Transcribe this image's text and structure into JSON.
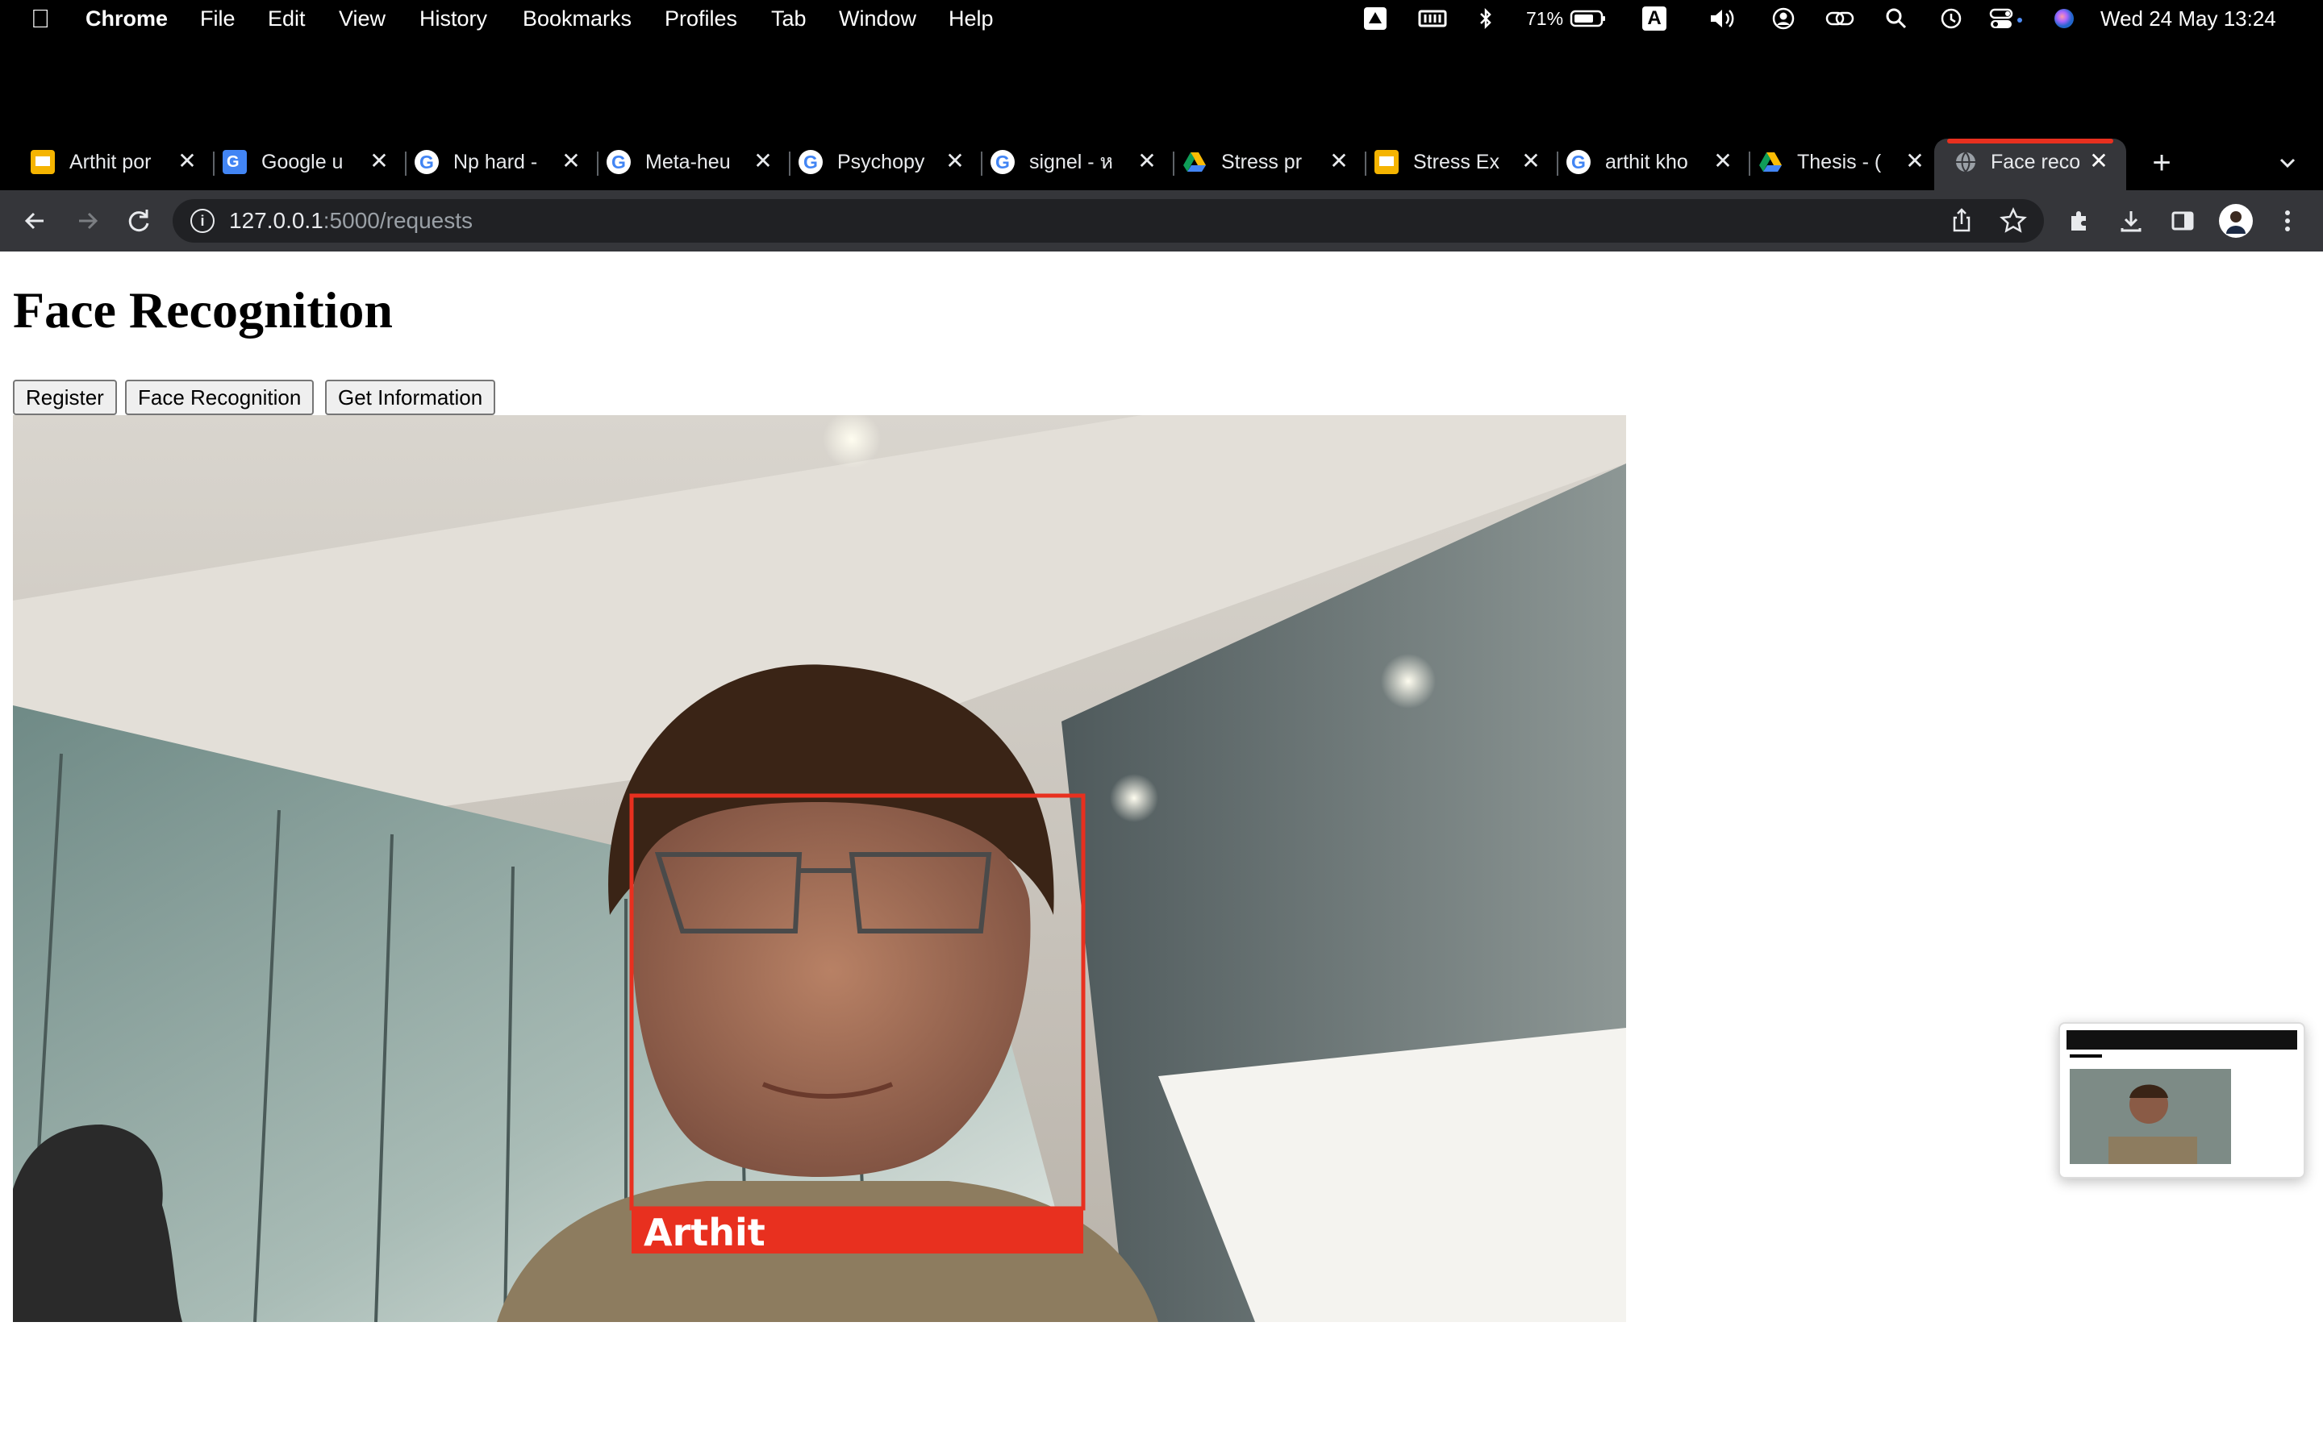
{
  "menubar": {
    "app": "Chrome",
    "items": [
      "File",
      "Edit",
      "View",
      "History",
      "Bookmarks",
      "Profiles",
      "Tab",
      "Window",
      "Help"
    ],
    "battery": "71%",
    "input_source": "A",
    "datetime": "Wed 24 May  13:24"
  },
  "tabs": [
    {
      "label": "Arthit por",
      "icon": "slides-icon"
    },
    {
      "label": "Google u",
      "icon": "translate-icon"
    },
    {
      "label": "Np hard -",
      "icon": "google-icon"
    },
    {
      "label": "Meta-heu",
      "icon": "google-icon"
    },
    {
      "label": "Psychopy",
      "icon": "google-icon"
    },
    {
      "label": "signel - ห",
      "icon": "google-icon"
    },
    {
      "label": "Stress pr",
      "icon": "drive-icon"
    },
    {
      "label": "Stress Ex",
      "icon": "slides-icon"
    },
    {
      "label": "arthit kho",
      "icon": "google-icon"
    },
    {
      "label": "Thesis - (",
      "icon": "drive-icon"
    },
    {
      "label": "Face reco",
      "icon": "globe-icon",
      "active": true
    }
  ],
  "omnibox": {
    "host": "127.0.0.1",
    "path": ":5000/requests"
  },
  "page": {
    "title": "Face Recognition",
    "buttons": {
      "register": "Register",
      "face_recognition": "Face Recognition",
      "get_information": "Get Information"
    }
  },
  "detection": {
    "name": "Arthit",
    "box_color": "#e8301f"
  },
  "colors": {
    "chrome_dark": "#35363a",
    "active_tab_accent": "#e8301f"
  }
}
